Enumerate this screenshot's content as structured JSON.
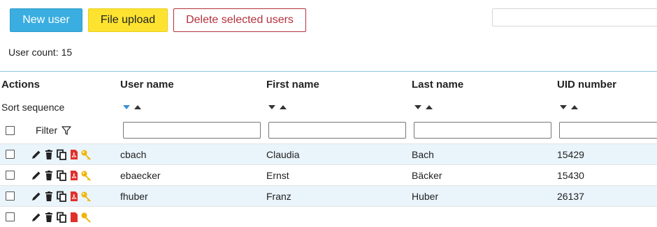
{
  "toolbar": {
    "new_user_label": "New user",
    "file_upload_label": "File upload",
    "delete_label": "Delete selected users",
    "search_placeholder": ""
  },
  "user_count": {
    "label": "User count:",
    "value": "15"
  },
  "table": {
    "columns": [
      "Actions",
      "User name",
      "First name",
      "Last name",
      "UID number"
    ],
    "sort_label": "Sort sequence",
    "filter_label": "Filter",
    "rows": [
      {
        "user_name": "cbach",
        "first_name": "Claudia",
        "last_name": "Bach",
        "uid": "15429"
      },
      {
        "user_name": "ebaecker",
        "first_name": "Ernst",
        "last_name": "Bäcker",
        "uid": "15430"
      },
      {
        "user_name": "fhuber",
        "first_name": "Franz",
        "last_name": "Huber",
        "uid": "26137"
      }
    ]
  },
  "colors": {
    "new_user_bg": "#3aaee0",
    "file_upload_bg": "#fde330",
    "delete_border": "#b3303b",
    "row_alt_bg": "#e9f4fb",
    "table_top_border": "#8ac7de",
    "pdf_icon": "#e0302b",
    "key_icon": "#f0b400",
    "active_sort": "#3d8fd6"
  },
  "icons": [
    "edit-icon",
    "trash-icon",
    "copy-icon",
    "pdf-icon",
    "key-icon",
    "filter-icon",
    "sort-down-icon",
    "sort-up-icon"
  ]
}
